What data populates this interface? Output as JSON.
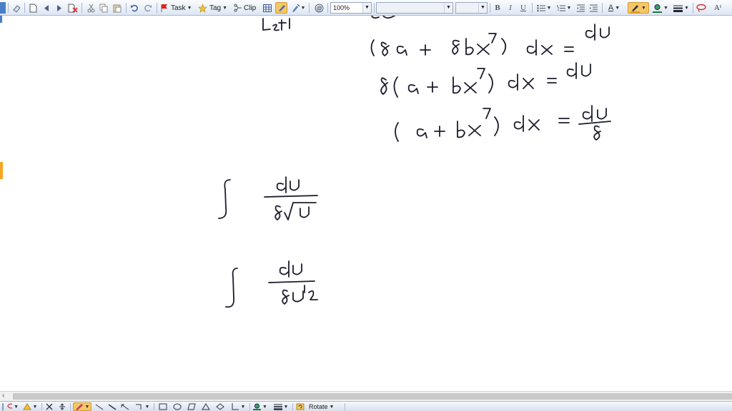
{
  "toolbar": {
    "task_label": "Task",
    "tag_label": "Tag",
    "clip_label": "Clip",
    "zoom_value": "100%",
    "font_family_value": "",
    "font_size_value": "",
    "bold_label": "B",
    "italic_label": "I",
    "underline_label": "U",
    "text_style_label": "A",
    "text_format_label": "Aᴵ"
  },
  "bottombar": {
    "rotate_label": "Rotate"
  },
  "colors": {
    "accent": "#f6c766",
    "ink": "#1c1c2c",
    "toolbar_bg": "#dde6f3",
    "side_accent": "#f5a623"
  }
}
